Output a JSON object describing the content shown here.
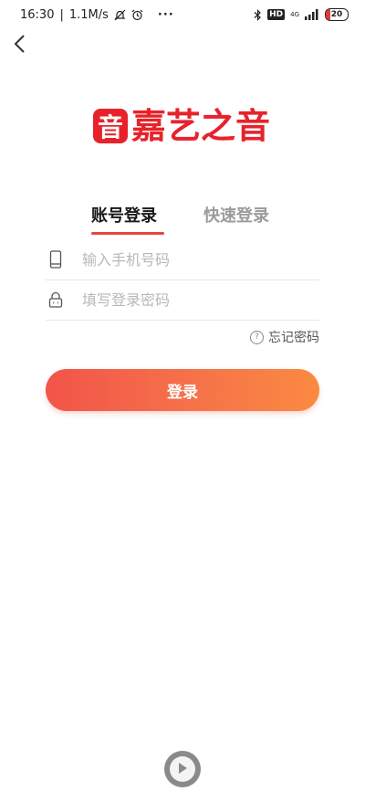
{
  "status_bar": {
    "time": "16:30",
    "speed": "1.1M/s",
    "more": "···",
    "hd": "HD",
    "net": "4G",
    "battery": "20"
  },
  "logo": {
    "mark": "音",
    "text": "嘉艺之音",
    "color": "#e8222b"
  },
  "tabs": {
    "account": "账号登录",
    "quick": "快速登录"
  },
  "form": {
    "phone_placeholder": "输入手机号码",
    "password_placeholder": "填写登录密码",
    "forgot": "忘记密码",
    "help_glyph": "?",
    "login": "登录"
  },
  "colors": {
    "accent": "#e8463b",
    "button_start": "#f25449",
    "button_end": "#fb8a41"
  },
  "icons": [
    "back-icon",
    "phone-icon",
    "lock-icon",
    "help-icon",
    "play-icon",
    "bluetooth-icon",
    "signal-icon",
    "mute-icon",
    "alarm-icon"
  ]
}
